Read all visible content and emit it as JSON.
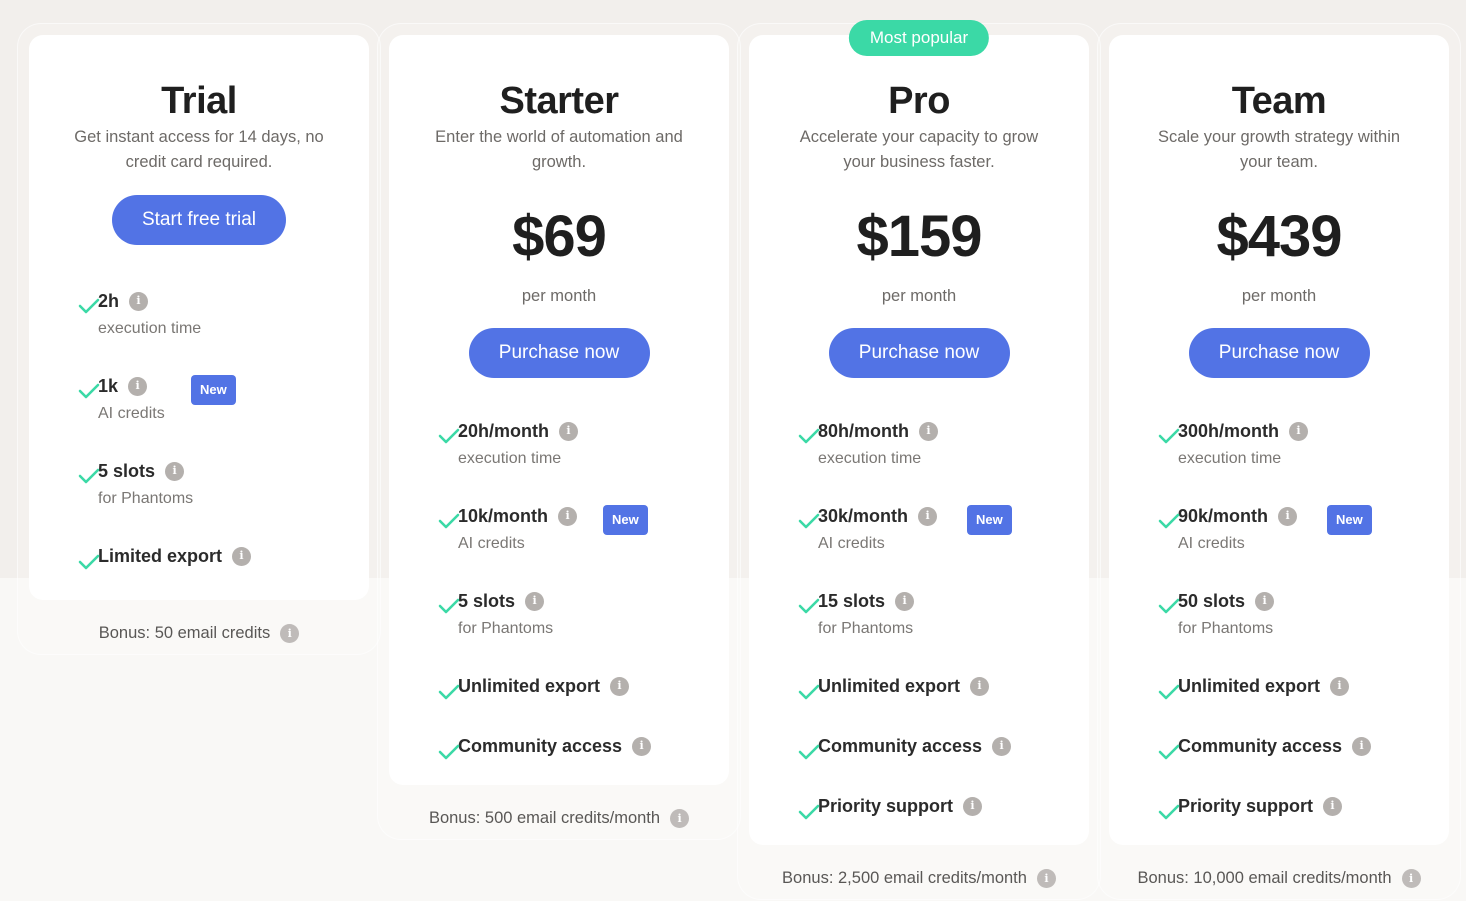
{
  "colors": {
    "accent": "#5273e5",
    "popular": "#3bd9a6",
    "check": "#3bd9a6",
    "bg_top": "#f2efec",
    "bg_bottom": "#f9f8f6"
  },
  "plans": [
    {
      "name": "Trial",
      "description": "Get instant access for 14 days, no credit card required.",
      "cta": "Start free trial",
      "features": [
        {
          "main": "2h",
          "sub": "execution time",
          "new": false
        },
        {
          "main": "1k",
          "sub": "AI credits",
          "new": true
        },
        {
          "main": "5 slots",
          "sub": "for Phantoms",
          "new": false
        },
        {
          "main": "Limited export",
          "sub": null,
          "new": false
        }
      ],
      "bonus": "Bonus: 50 email credits"
    },
    {
      "name": "Starter",
      "description": "Enter the world of automation and growth.",
      "price": "$69",
      "period": "per month",
      "cta": "Purchase now",
      "features": [
        {
          "main": "20h/month",
          "sub": "execution time",
          "new": false
        },
        {
          "main": "10k/month",
          "sub": "AI credits",
          "new": true
        },
        {
          "main": "5 slots",
          "sub": "for Phantoms",
          "new": false
        },
        {
          "main": "Unlimited export",
          "sub": null,
          "new": false
        },
        {
          "main": "Community access",
          "sub": null,
          "new": false
        }
      ],
      "bonus": "Bonus: 500 email credits/month"
    },
    {
      "name": "Pro",
      "badge": "Most popular",
      "description": "Accelerate your capacity to grow your business faster.",
      "price": "$159",
      "period": "per month",
      "cta": "Purchase now",
      "features": [
        {
          "main": "80h/month",
          "sub": "execution time",
          "new": false
        },
        {
          "main": "30k/month",
          "sub": "AI credits",
          "new": true
        },
        {
          "main": "15 slots",
          "sub": "for Phantoms",
          "new": false
        },
        {
          "main": "Unlimited export",
          "sub": null,
          "new": false
        },
        {
          "main": "Community access",
          "sub": null,
          "new": false
        },
        {
          "main": "Priority support",
          "sub": null,
          "new": false
        }
      ],
      "bonus": "Bonus: 2,500 email credits/month"
    },
    {
      "name": "Team",
      "description": "Scale your growth strategy within your team.",
      "price": "$439",
      "period": "per month",
      "cta": "Purchase now",
      "features": [
        {
          "main": "300h/month",
          "sub": "execution time",
          "new": false
        },
        {
          "main": "90k/month",
          "sub": "AI credits",
          "new": true
        },
        {
          "main": "50 slots",
          "sub": "for Phantoms",
          "new": false
        },
        {
          "main": "Unlimited export",
          "sub": null,
          "new": false
        },
        {
          "main": "Community access",
          "sub": null,
          "new": false
        },
        {
          "main": "Priority support",
          "sub": null,
          "new": false
        }
      ],
      "bonus": "Bonus: 10,000 email credits/month"
    }
  ],
  "labels": {
    "new_badge": "New",
    "info_glyph": "i"
  }
}
